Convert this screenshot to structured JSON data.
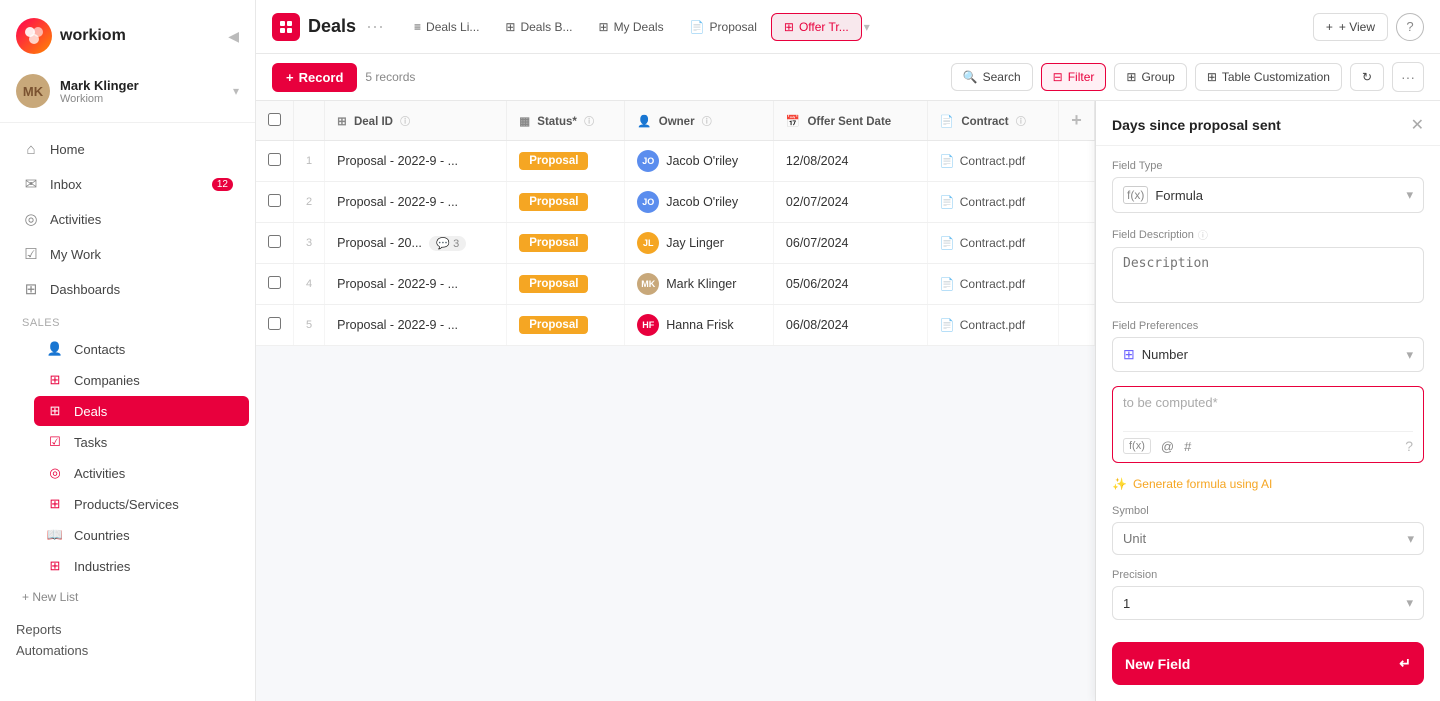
{
  "app": {
    "name": "workiom",
    "logo_char": "W"
  },
  "user": {
    "name": "Mark Klinger",
    "company": "Workiom",
    "avatar_initials": "MK",
    "avatar_bg": "#c8a87a"
  },
  "sidebar": {
    "nav_items": [
      {
        "id": "home",
        "label": "Home",
        "icon": "⌂",
        "badge": null
      },
      {
        "id": "inbox",
        "label": "Inbox",
        "icon": "✉",
        "badge": "12"
      },
      {
        "id": "activities-top",
        "label": "Activities",
        "icon": "◎",
        "badge": null
      },
      {
        "id": "mywork",
        "label": "My Work",
        "icon": "☑",
        "badge": null
      },
      {
        "id": "dashboards",
        "label": "Dashboards",
        "icon": "⊞",
        "badge": null
      }
    ],
    "sales_section": "Sales",
    "sales_items": [
      {
        "id": "contacts",
        "label": "Contacts",
        "icon": "👤",
        "color": "#e8003d"
      },
      {
        "id": "companies",
        "label": "Companies",
        "icon": "⊞",
        "color": "#e8003d"
      },
      {
        "id": "deals",
        "label": "Deals",
        "icon": "⊞",
        "color": "#e8003d",
        "active": true
      },
      {
        "id": "tasks",
        "label": "Tasks",
        "icon": "☑",
        "color": "#e8003d"
      },
      {
        "id": "activities",
        "label": "Activities",
        "icon": "◎",
        "color": "#e8003d"
      },
      {
        "id": "products",
        "label": "Products/Services",
        "icon": "⊞",
        "color": "#e8003d"
      },
      {
        "id": "countries",
        "label": "Countries",
        "icon": "📖",
        "color": "#e8003d"
      },
      {
        "id": "industries",
        "label": "Industries",
        "icon": "⊞",
        "color": "#e8003d"
      }
    ],
    "new_list": "+ New List",
    "reports_label": "Reports",
    "automations_label": "Automations"
  },
  "topbar": {
    "page_icon": "⊞",
    "title": "Deals",
    "tabs": [
      {
        "id": "deals-list",
        "label": "Deals Li...",
        "icon": "≡"
      },
      {
        "id": "deals-board",
        "label": "Deals B...",
        "icon": "⊞"
      },
      {
        "id": "my-deals",
        "label": "My Deals",
        "icon": "⊞"
      },
      {
        "id": "proposal",
        "label": "Proposal",
        "icon": "📄"
      },
      {
        "id": "offer-tr",
        "label": "Offer Tr...",
        "icon": "⊞",
        "active": true
      }
    ],
    "tab_arrow_label": "▾",
    "view_label": "+ View",
    "help_label": "?"
  },
  "toolbar": {
    "record_label": "Record",
    "record_count": "5 records",
    "search_label": "Search",
    "filter_label": "Filter",
    "group_label": "Group",
    "customize_label": "Table Customization",
    "refresh_icon": "↻",
    "more_icon": "···"
  },
  "table": {
    "columns": [
      {
        "id": "deal_id",
        "label": "Deal ID",
        "icon": "⊞"
      },
      {
        "id": "status",
        "label": "Status*",
        "icon": "▦"
      },
      {
        "id": "owner",
        "label": "Owner",
        "icon": "👤"
      },
      {
        "id": "offer_sent_date",
        "label": "Offer Sent Date",
        "icon": "📅"
      },
      {
        "id": "contract",
        "label": "Contract",
        "icon": "📄"
      }
    ],
    "rows": [
      {
        "num": "1",
        "deal_id": "Proposal - 2022-9 - ...",
        "status": "Proposal",
        "owner": "Jacob O'riley",
        "owner_color": "#5b8dee",
        "owner_initials": "JO",
        "offer_sent_date": "12/08/2024",
        "contract": "Contract.pdf",
        "comments": null
      },
      {
        "num": "2",
        "deal_id": "Proposal - 2022-9 - ...",
        "status": "Proposal",
        "owner": "Jacob O'riley",
        "owner_color": "#5b8dee",
        "owner_initials": "JO",
        "offer_sent_date": "02/07/2024",
        "contract": "Contract.pdf",
        "comments": null
      },
      {
        "num": "3",
        "deal_id": "Proposal - 20...",
        "status": "Proposal",
        "owner": "Jay Linger",
        "owner_color": "#f5a623",
        "owner_initials": "JL",
        "offer_sent_date": "06/07/2024",
        "contract": "Contract.pdf",
        "comments": "3"
      },
      {
        "num": "4",
        "deal_id": "Proposal - 2022-9 - ...",
        "status": "Proposal",
        "owner": "Mark Klinger",
        "owner_color": "#c8a87a",
        "owner_initials": "MK",
        "offer_sent_date": "05/06/2024",
        "contract": "Contract.pdf",
        "comments": null
      },
      {
        "num": "5",
        "deal_id": "Proposal - 2022-9 - ...",
        "status": "Proposal",
        "owner": "Hanna Frisk",
        "owner_color": "#e8003d",
        "owner_initials": "HF",
        "offer_sent_date": "06/08/2024",
        "contract": "Contract.pdf",
        "comments": null
      }
    ]
  },
  "panel": {
    "title": "Days since proposal sent",
    "close_icon": "✕",
    "field_type_label": "Field Type",
    "field_type_value": "Formula",
    "field_type_icon": "f(x)",
    "field_desc_label": "Field Description",
    "field_desc_placeholder": "Description",
    "field_prefs_label": "Field Preferences",
    "field_prefs_value": "Number",
    "field_prefs_icon": "⊞",
    "formula_placeholder": "to be computed*",
    "formula_tools": [
      {
        "id": "fx",
        "label": "f(x)"
      },
      {
        "id": "at",
        "label": "@"
      },
      {
        "id": "hash",
        "label": "#"
      }
    ],
    "ai_label": "Generate formula using AI",
    "symbol_label": "Symbol",
    "unit_placeholder": "Unit",
    "precision_label": "Precision",
    "precision_value": "1",
    "new_field_label": "New Field",
    "new_field_icon": "↵"
  }
}
